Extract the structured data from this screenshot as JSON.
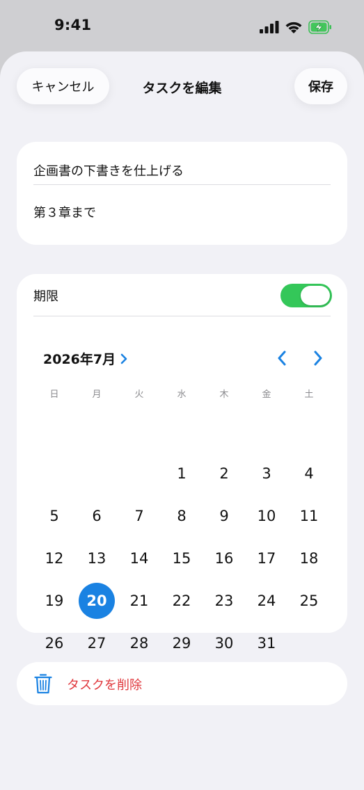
{
  "status_bar": {
    "time": "9:41",
    "icons": [
      "signal-icon",
      "wifi-icon",
      "battery-charging-icon"
    ]
  },
  "header": {
    "cancel_label": "キャンセル",
    "title": "タスクを編集",
    "save_label": "保存"
  },
  "task": {
    "title": "企画書の下書きを仕上げる",
    "notes": "第３章まで"
  },
  "deadline": {
    "label": "期限",
    "enabled": true
  },
  "calendar": {
    "month_label": "2026年7月",
    "weekdays": [
      "日",
      "月",
      "火",
      "水",
      "木",
      "金",
      "土"
    ],
    "first_weekday_index": 3,
    "days_in_month": 31,
    "selected_day": 20
  },
  "delete": {
    "label": "タスクを削除"
  },
  "colors": {
    "accent": "#1a82e2",
    "toggle_on": "#34c759",
    "destructive": "#e0373c",
    "background": "#f1f1f6"
  }
}
